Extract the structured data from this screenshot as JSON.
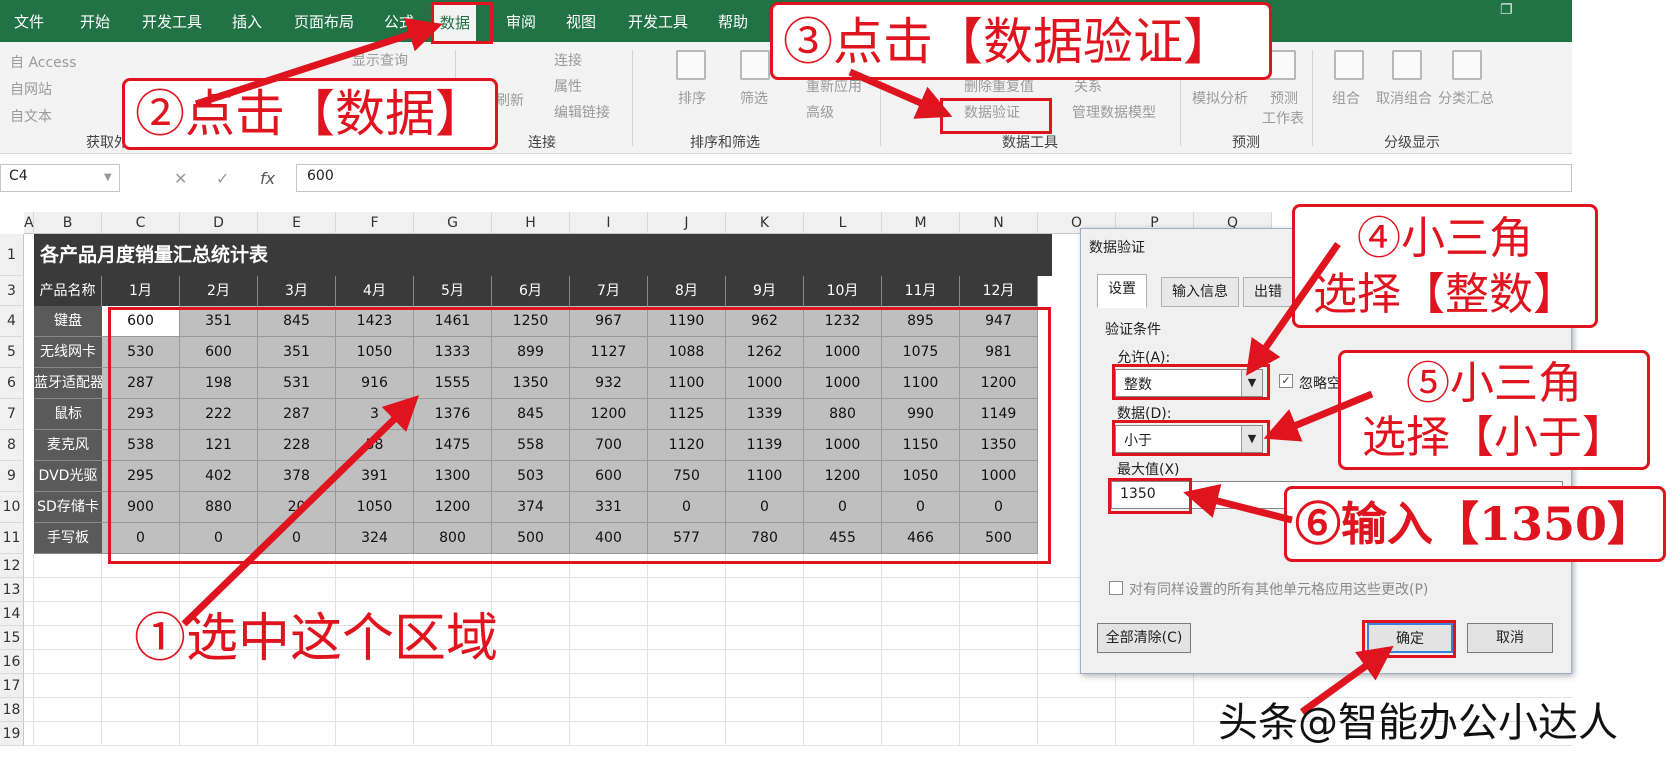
{
  "ribbon_tabs": [
    "文件",
    "开始",
    "开发工具",
    "插入",
    "页面布局",
    "公式",
    "数据",
    "审阅",
    "视图",
    "开发工具",
    "帮助"
  ],
  "ribbon": {
    "external": [
      "自 Access",
      "自网站",
      "自文本"
    ],
    "external_group": "获取外",
    "query_label": "显示查询",
    "refresh_label": "刷新",
    "connections": [
      "连接",
      "属性",
      "编辑链接"
    ],
    "connections_group": "连接",
    "sort_label": "排序",
    "filter_label": "筛选",
    "reapply_label": "重新应用",
    "advanced_label": "高级",
    "sort_group": "排序和筛选",
    "remove_dup_label": "删除重复值",
    "relationships_label": "关系",
    "data_validation_label": "数据验证",
    "manage_model_label": "管理数据模型",
    "data_tools_group": "数据工具",
    "whatif_label": "模拟分析",
    "forecast_label_1": "预测",
    "forecast_label_2": "工作表",
    "forecast_group": "预测",
    "group_label": "组合",
    "ungroup_label": "取消组合",
    "subtotal_label": "分类汇总",
    "outline_group": "分级显示"
  },
  "formula_bar": {
    "name_box": "C4",
    "cancel_icon": "✕",
    "enter_icon": "✓",
    "fx": "fx",
    "value": "600"
  },
  "columns": [
    "A",
    "B",
    "C",
    "D",
    "E",
    "F",
    "G",
    "H",
    "I",
    "J",
    "K",
    "L",
    "M",
    "N",
    "O",
    "P",
    "Q"
  ],
  "rows": [
    "1",
    "3",
    "4",
    "5",
    "6",
    "7",
    "8",
    "9",
    "10",
    "11",
    "12",
    "13",
    "14",
    "15",
    "16",
    "17",
    "18",
    "19"
  ],
  "sheet": {
    "title": "各产品月度销量汇总统计表",
    "header_first": "产品名称",
    "months": [
      "1月",
      "2月",
      "3月",
      "4月",
      "5月",
      "6月",
      "7月",
      "8月",
      "9月",
      "10月",
      "11月",
      "12月"
    ],
    "products": [
      {
        "name": "键盘",
        "values": [
          "600",
          "351",
          "845",
          "1423",
          "1461",
          "1250",
          "967",
          "1190",
          "962",
          "1232",
          "895",
          "947"
        ]
      },
      {
        "name": "无线网卡",
        "values": [
          "530",
          "600",
          "351",
          "1050",
          "1333",
          "899",
          "1127",
          "1088",
          "1262",
          "1000",
          "1075",
          "981"
        ]
      },
      {
        "name": "蓝牙适配器",
        "values": [
          "287",
          "198",
          "531",
          "916",
          "1555",
          "1350",
          "932",
          "1100",
          "1000",
          "1000",
          "1100",
          "1200"
        ]
      },
      {
        "name": "鼠标",
        "values": [
          "293",
          "222",
          "287",
          "3",
          "1376",
          "845",
          "1200",
          "1125",
          "1339",
          "880",
          "990",
          "1149"
        ]
      },
      {
        "name": "麦克风",
        "values": [
          "538",
          "121",
          "228",
          "58",
          "1475",
          "558",
          "700",
          "1120",
          "1139",
          "1000",
          "1150",
          "1350"
        ]
      },
      {
        "name": "DVD光驱",
        "values": [
          "295",
          "402",
          "378",
          "391",
          "1300",
          "503",
          "600",
          "750",
          "1100",
          "1200",
          "1050",
          "1000"
        ]
      },
      {
        "name": "SD存储卡",
        "values": [
          "900",
          "880",
          "20",
          "1050",
          "1200",
          "374",
          "331",
          "0",
          "0",
          "0",
          "0",
          "0"
        ]
      },
      {
        "name": "手写板",
        "values": [
          "0",
          "0",
          "0",
          "324",
          "800",
          "500",
          "400",
          "577",
          "780",
          "455",
          "466",
          "500"
        ]
      }
    ]
  },
  "dialog": {
    "title": "数据验证",
    "tabs": [
      "设置",
      "输入信息",
      "出错"
    ],
    "section": "验证条件",
    "allow_label": "允许(A):",
    "allow_value": "整数",
    "ignore_blank": "忽略空",
    "data_label": "数据(D):",
    "data_value": "小于",
    "max_label": "最大值(X)",
    "max_value": "1350",
    "apply_all": "对有同样设置的所有其他单元格应用这些更改(P)",
    "clear_all": "全部清除(C)",
    "ok": "确定",
    "cancel": "取消"
  },
  "annotations": {
    "step1": "①选中这个区域",
    "step2": "②点击【数据】",
    "step3": "③点击【数据验证】",
    "step4_line1": "④小三角",
    "step4_line2": "选择【整数】",
    "step5_line1": "⑤小三角",
    "step5_line2": "选择【小于】",
    "step6": "⑥输入【1350】",
    "accent": "#e0141e"
  },
  "watermark": "头条@智能办公小达人"
}
